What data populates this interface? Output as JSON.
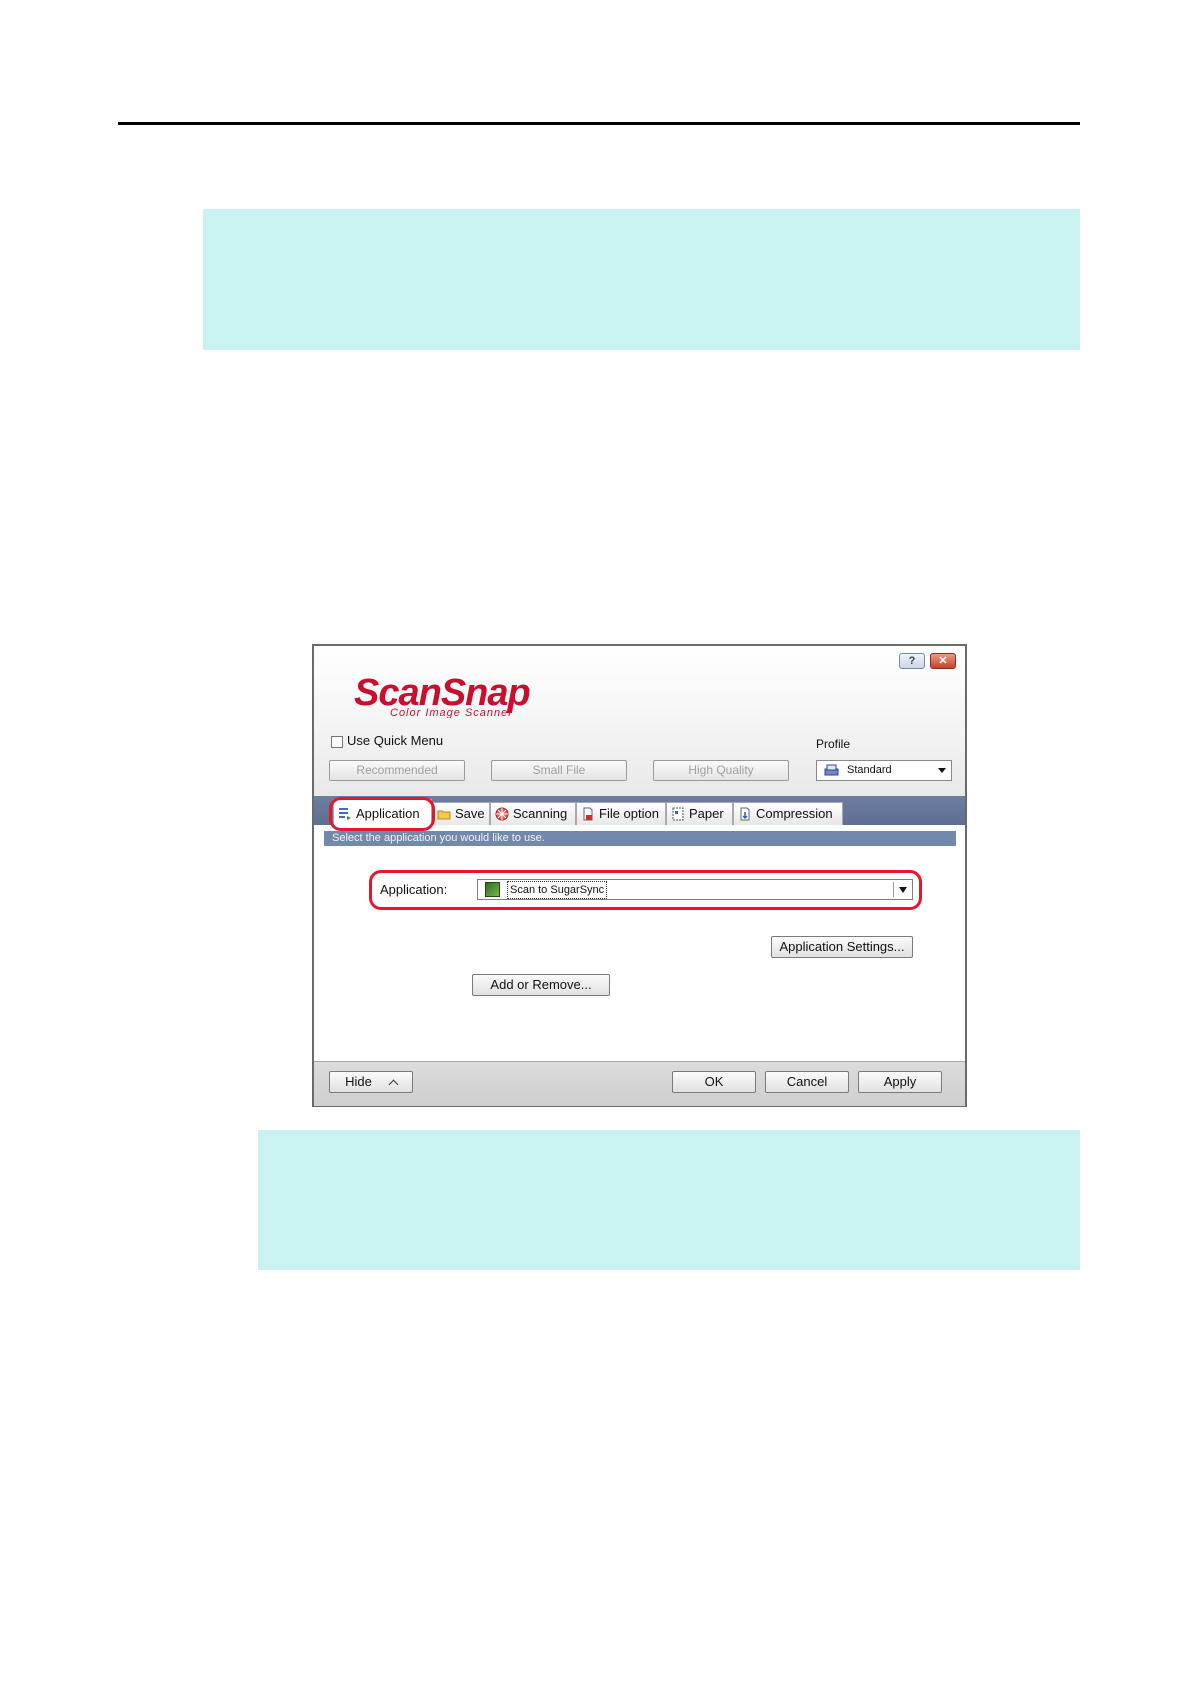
{
  "dialog": {
    "title_buttons": {
      "help": "?",
      "close": "✕"
    },
    "logo": {
      "main": "ScanSnap",
      "sub": "Color Image Scanner"
    },
    "quick_menu": {
      "label": "Use Quick Menu",
      "checked": false
    },
    "presets": [
      "Recommended",
      "Small File",
      "High Quality"
    ],
    "profile": {
      "label": "Profile",
      "value": "Standard"
    },
    "tabs": [
      {
        "label": "Application",
        "icon": "application-icon",
        "active": true
      },
      {
        "label": "Save",
        "icon": "folder-icon"
      },
      {
        "label": "Scanning",
        "icon": "scanning-icon"
      },
      {
        "label": "File option",
        "icon": "file-option-icon"
      },
      {
        "label": "Paper",
        "icon": "paper-icon"
      },
      {
        "label": "Compression",
        "icon": "compression-icon"
      }
    ],
    "panel": {
      "caption": "Select the application you would like to use.",
      "application_label": "Application:",
      "application_value": "Scan to SugarSync",
      "settings_button": "Application Settings...",
      "add_remove_button": "Add or Remove..."
    },
    "footer": {
      "hide": "Hide",
      "ok": "OK",
      "cancel": "Cancel",
      "apply": "Apply"
    }
  },
  "colors": {
    "highlight_ring": "#e4172b",
    "note_background": "#c8f3f1",
    "tab_band": "#5f7094",
    "caption_bar": "#7389ab",
    "logo_red": "#c8102e"
  }
}
